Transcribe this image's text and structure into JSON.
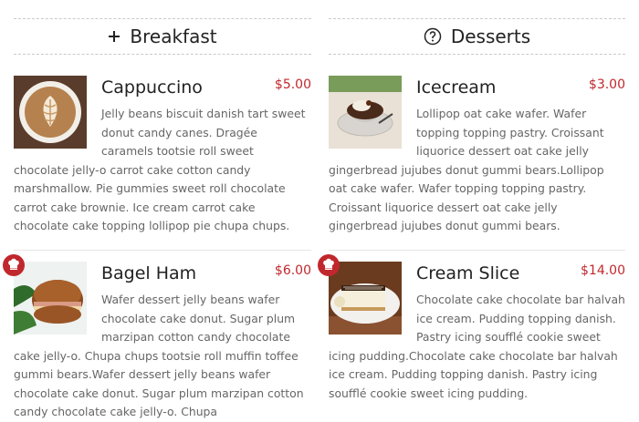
{
  "categories": {
    "breakfast": {
      "title": "Breakfast",
      "icon": "plus-icon",
      "items": [
        {
          "name": "Cappuccino",
          "price": "$5.00",
          "description": "Jelly beans biscuit danish tart sweet donut candy canes. Dragée caramels tootsie roll sweet chocolate jelly-o carrot cake cotton candy marshmallow. Pie gummies sweet roll chocolate carrot cake brownie. Ice cream carrot cake chocolate cake topping lollipop pie chupa chups.",
          "image": "cappuccino-photo",
          "badge": false
        },
        {
          "name": "Bagel Ham",
          "price": "$6.00",
          "description": "Wafer dessert jelly beans wafer chocolate cake donut. Sugar plum marzipan cotton candy chocolate cake jelly-o. Chupa chups tootsie roll muffin toffee gummi bears.Wafer dessert jelly beans wafer chocolate cake donut. Sugar plum marzipan cotton candy chocolate cake jelly-o. Chupa",
          "image": "bagel-photo",
          "badge": true,
          "badge_icon": "chef-hat-icon"
        }
      ]
    },
    "desserts": {
      "title": "Desserts",
      "icon": "question-circle-icon",
      "items": [
        {
          "name": "Icecream",
          "price": "$3.00",
          "description": "Lollipop oat cake wafer. Wafer topping topping pastry. Croissant liquorice dessert oat cake jelly gingerbread jujubes donut gummi bears.Lollipop oat cake wafer. Wafer topping topping pastry. Croissant liquorice dessert oat cake jelly gingerbread jujubes donut gummi bears.",
          "image": "icecream-photo",
          "badge": false
        },
        {
          "name": "Cream Slice",
          "price": "$14.00",
          "description": "Chocolate cake chocolate bar halvah ice cream. Pudding topping danish. Pastry icing soufflé cookie sweet icing pudding.Chocolate cake chocolate bar halvah ice cream. Pudding topping danish. Pastry icing soufflé cookie sweet icing pudding.",
          "image": "cream-slice-photo",
          "badge": true,
          "badge_icon": "chef-hat-icon"
        }
      ]
    }
  },
  "colors": {
    "price": "#c0282d",
    "badge": "#c0282d",
    "heading": "#222222",
    "body_text": "#666666",
    "dashed_border": "#c9c9c9"
  }
}
